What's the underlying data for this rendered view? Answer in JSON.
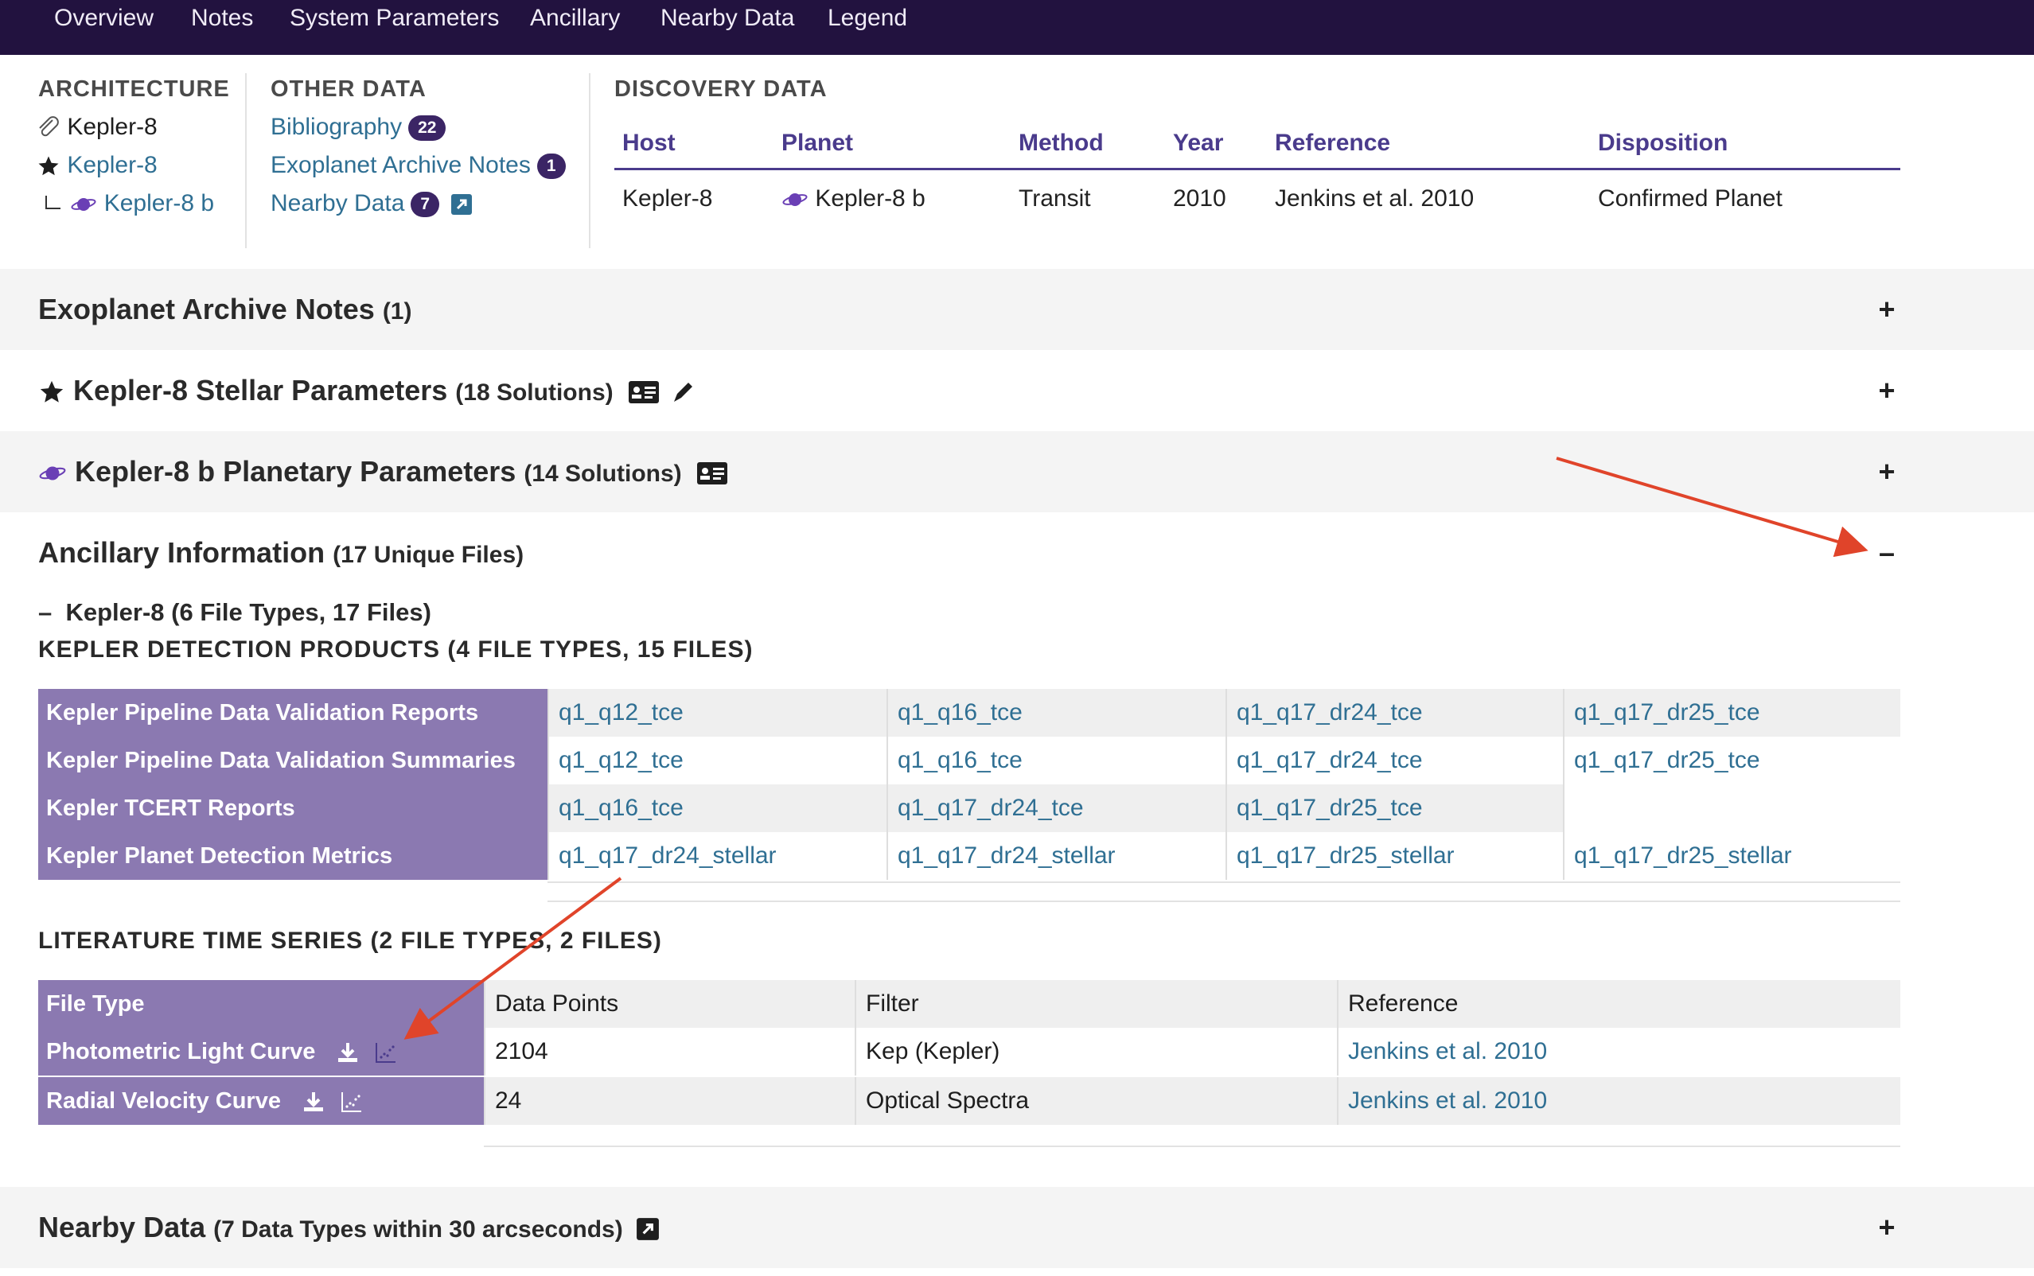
{
  "nav": {
    "items": [
      "Overview",
      "Notes",
      "System Parameters",
      "Ancillary",
      "Nearby Data",
      "Legend"
    ]
  },
  "architecture": {
    "heading": "ARCHITECTURE",
    "system": "Kepler-8",
    "star": "Kepler-8",
    "planet": "Kepler-8 b"
  },
  "other_data": {
    "heading": "OTHER DATA",
    "items": [
      {
        "label": "Bibliography",
        "count": "22"
      },
      {
        "label": "Exoplanet Archive Notes",
        "count": "1"
      },
      {
        "label": "Nearby Data",
        "count": "7"
      }
    ]
  },
  "discovery": {
    "heading": "DISCOVERY DATA",
    "columns": [
      "Host",
      "Planet",
      "Method",
      "Year",
      "Reference",
      "Disposition"
    ],
    "row": {
      "host": "Kepler-8",
      "planet": "Kepler-8 b",
      "method": "Transit",
      "year": "2010",
      "reference": "Jenkins et al. 2010",
      "disposition": "Confirmed Planet"
    }
  },
  "sections": {
    "notes": {
      "title": "Exoplanet Archive Notes",
      "count": "(1)",
      "toggle": "+"
    },
    "stellar": {
      "title": "Kepler-8 Stellar Parameters",
      "count": "(18 Solutions)",
      "toggle": "+"
    },
    "planetary": {
      "title": "Kepler-8 b Planetary Parameters",
      "count": "(14 Solutions)",
      "toggle": "+"
    },
    "ancillary": {
      "title": "Ancillary Information",
      "count": "(17 Unique Files)",
      "toggle": "–"
    },
    "nearby": {
      "title": "Nearby Data",
      "count": "(7 Data Types within 30 arcseconds)",
      "toggle": "+"
    }
  },
  "ancillary": {
    "subgroup_toggle": "–",
    "subgroup": "Kepler-8 (6 File Types, 17 Files)",
    "kepler_heading": "KEPLER DETECTION PRODUCTS (4 FILE TYPES, 15 FILES)",
    "kepler_rows": [
      {
        "label": "Kepler Pipeline Data Validation Reports",
        "links": [
          "q1_q12_tce",
          "q1_q16_tce",
          "q1_q17_dr24_tce",
          "q1_q17_dr25_tce"
        ]
      },
      {
        "label": "Kepler Pipeline Data Validation Summaries",
        "links": [
          "q1_q12_tce",
          "q1_q16_tce",
          "q1_q17_dr24_tce",
          "q1_q17_dr25_tce"
        ]
      },
      {
        "label": "Kepler TCERT Reports",
        "links": [
          "q1_q16_tce",
          "q1_q17_dr24_tce",
          "q1_q17_dr25_tce"
        ]
      },
      {
        "label": "Kepler Planet Detection Metrics",
        "links": [
          "q1_q17_dr24_stellar",
          "q1_q17_dr24_stellar",
          "q1_q17_dr25_stellar",
          "q1_q17_dr25_stellar"
        ]
      }
    ],
    "lit_heading": "LITERATURE TIME SERIES (2 FILE TYPES, 2 FILES)",
    "lit_columns": [
      "File Type",
      "Data Points",
      "Filter",
      "Reference"
    ],
    "lit_rows": [
      {
        "file_type": "Photometric Light Curve",
        "data_points": "2104",
        "filter": "Kep (Kepler)",
        "reference": "Jenkins et al. 2010"
      },
      {
        "file_type": "Radial Velocity Curve",
        "data_points": "24",
        "filter": "Optical Spectra",
        "reference": "Jenkins et al. 2010"
      }
    ]
  },
  "colors": {
    "nav_bg": "#22123f",
    "purple_header": "#8b79b1",
    "badge": "#3b2565",
    "link": "#2f6f93",
    "annotation_arrow": "#e0442a"
  }
}
